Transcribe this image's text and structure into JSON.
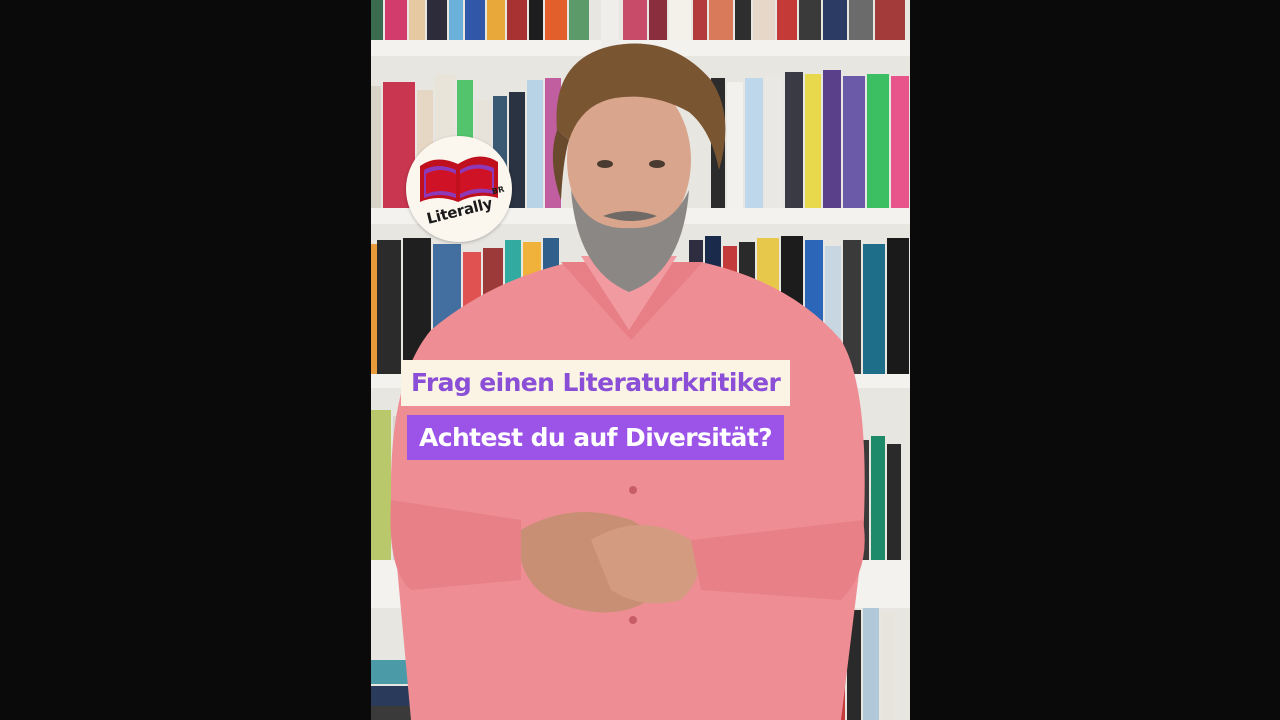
{
  "overlay": {
    "logo_text": "Literally",
    "logo_badge": "BR",
    "caption_top": "Frag einen Literaturkritiker",
    "caption_bottom": "Achtest du auf Diversität?"
  },
  "colors": {
    "caption_top_bg": "#fbf3e3",
    "caption_top_text": "#8a4fd6",
    "caption_bottom_bg": "#9b53e8",
    "caption_bottom_text": "#ffffff",
    "shirt": "#ee8d94",
    "logo_book": "#c0101e",
    "letterbox": "#0a0a0a"
  }
}
